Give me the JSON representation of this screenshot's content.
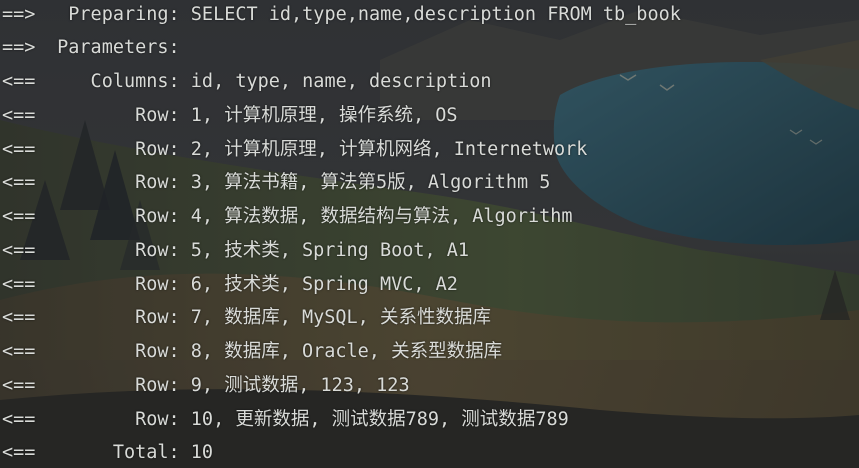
{
  "console": {
    "lines": [
      {
        "prefix": "==>",
        "label": "  Preparing:",
        "value": " SELECT id,type,name,description FROM tb_book"
      },
      {
        "prefix": "==>",
        "label": " Parameters:",
        "value": ""
      },
      {
        "prefix": "<==",
        "label": "    Columns:",
        "value": " id, type, name, description"
      },
      {
        "prefix": "<==",
        "label": "        Row:",
        "value": " 1, 计算机原理, 操作系统, OS"
      },
      {
        "prefix": "<==",
        "label": "        Row:",
        "value": " 2, 计算机原理, 计算机网络, Internetwork"
      },
      {
        "prefix": "<==",
        "label": "        Row:",
        "value": " 3, 算法书籍, 算法第5版, Algorithm 5"
      },
      {
        "prefix": "<==",
        "label": "        Row:",
        "value": " 4, 算法数据, 数据结构与算法, Algorithm"
      },
      {
        "prefix": "<==",
        "label": "        Row:",
        "value": " 5, 技术类, Spring Boot, A1"
      },
      {
        "prefix": "<==",
        "label": "        Row:",
        "value": " 6, 技术类, Spring MVC, A2"
      },
      {
        "prefix": "<==",
        "label": "        Row:",
        "value": " 7, 数据库, MySQL, 关系性数据库"
      },
      {
        "prefix": "<==",
        "label": "        Row:",
        "value": " 8, 数据库, Oracle, 关系型数据库"
      },
      {
        "prefix": "<==",
        "label": "        Row:",
        "value": " 9, 测试数据, 123, 123"
      },
      {
        "prefix": "<==",
        "label": "        Row:",
        "value": " 10, 更新数据, 测试数据789, 测试数据789"
      },
      {
        "prefix": "<==",
        "label": "      Total:",
        "value": " 10"
      }
    ]
  }
}
